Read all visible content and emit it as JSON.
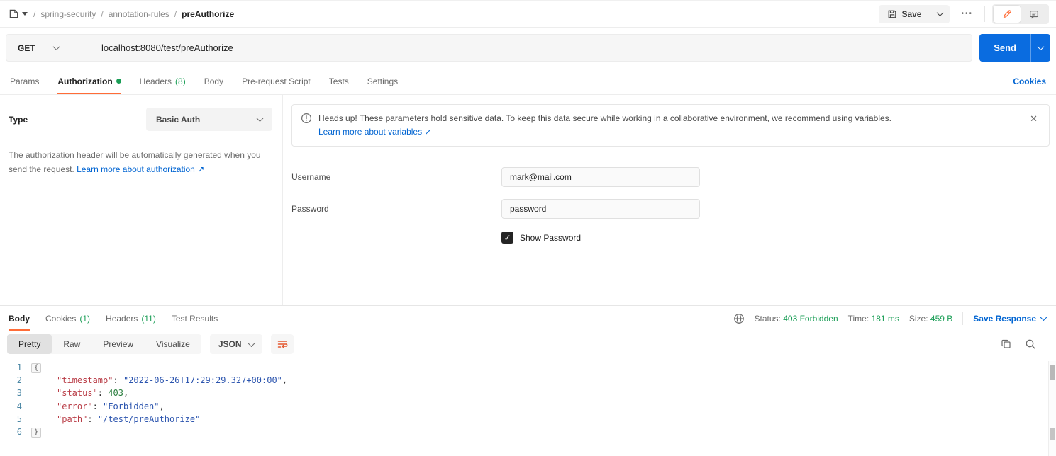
{
  "colors": {
    "accent_orange": "#ff6c37",
    "link_blue": "#0265d2",
    "send_blue": "#0a6ce0",
    "green": "#1a9e56"
  },
  "topbar": {
    "breadcrumb": {
      "collection": "spring-security",
      "folder": "annotation-rules",
      "current": "preAuthorize",
      "separator": "/"
    },
    "save_label": "Save",
    "more_label": "•••"
  },
  "request": {
    "method": "GET",
    "url": "localhost:8080/test/preAuthorize",
    "send_label": "Send"
  },
  "request_tabs": {
    "params": "Params",
    "authorization": "Authorization",
    "headers": "Headers",
    "headers_count": "(8)",
    "body": "Body",
    "prerequest": "Pre-request Script",
    "tests": "Tests",
    "settings": "Settings",
    "cookies": "Cookies"
  },
  "auth": {
    "type_label": "Type",
    "type_value": "Basic Auth",
    "help_text": "The authorization header will be automatically generated when you send the request. ",
    "help_link": "Learn more about authorization ↗",
    "banner": {
      "text": "Heads up! These parameters hold sensitive data. To keep this data secure while working in a collaborative environment, we recommend using variables.",
      "link": "Learn more about variables ↗",
      "close": "✕"
    },
    "username_label": "Username",
    "username_value": "mark@mail.com",
    "password_label": "Password",
    "password_value": "password",
    "show_password_label": "Show Password",
    "show_password_checked": "✓"
  },
  "response": {
    "tabs": {
      "body": "Body",
      "cookies": "Cookies",
      "cookies_count": "(1)",
      "headers": "Headers",
      "headers_count": "(11)",
      "test_results": "Test Results"
    },
    "meta": {
      "status_label": "Status:",
      "status_value": "403 Forbidden",
      "time_label": "Time:",
      "time_value": "181 ms",
      "size_label": "Size:",
      "size_value": "459 B",
      "save_response": "Save Response"
    },
    "view": {
      "pretty": "Pretty",
      "raw": "Raw",
      "preview": "Preview",
      "visualize": "Visualize",
      "format": "JSON"
    },
    "body_lines": [
      {
        "num": "1",
        "indent": 0,
        "tokens": [
          {
            "t": "fold",
            "v": "{"
          }
        ]
      },
      {
        "num": "2",
        "indent": 1,
        "tokens": [
          {
            "t": "key",
            "v": "\"timestamp\""
          },
          {
            "t": "p",
            "v": ": "
          },
          {
            "t": "str",
            "v": "\"2022-06-26T17:29:29.327+00:00\""
          },
          {
            "t": "p",
            "v": ","
          }
        ]
      },
      {
        "num": "3",
        "indent": 1,
        "tokens": [
          {
            "t": "key",
            "v": "\"status\""
          },
          {
            "t": "p",
            "v": ": "
          },
          {
            "t": "num",
            "v": "403"
          },
          {
            "t": "p",
            "v": ","
          }
        ]
      },
      {
        "num": "4",
        "indent": 1,
        "tokens": [
          {
            "t": "key",
            "v": "\"error\""
          },
          {
            "t": "p",
            "v": ": "
          },
          {
            "t": "str",
            "v": "\"Forbidden\""
          },
          {
            "t": "p",
            "v": ","
          }
        ]
      },
      {
        "num": "5",
        "indent": 1,
        "tokens": [
          {
            "t": "key",
            "v": "\"path\""
          },
          {
            "t": "p",
            "v": ": "
          },
          {
            "t": "str",
            "v": "\""
          },
          {
            "t": "link",
            "v": "/test/preAuthorize"
          },
          {
            "t": "str",
            "v": "\""
          }
        ]
      },
      {
        "num": "6",
        "indent": 0,
        "tokens": [
          {
            "t": "fold",
            "v": "}"
          }
        ]
      }
    ]
  }
}
